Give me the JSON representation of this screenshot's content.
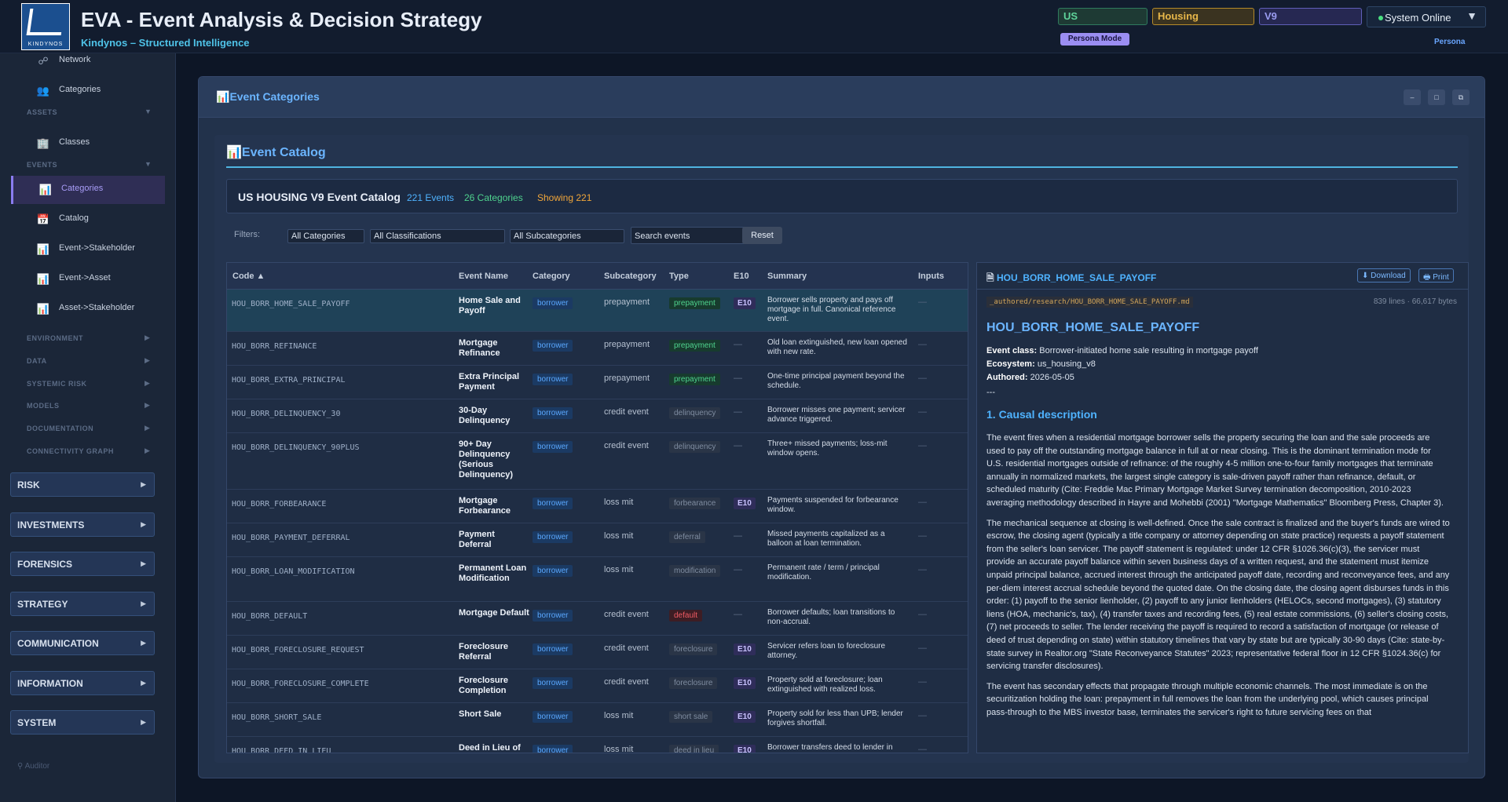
{
  "header": {
    "title": "EVA - Event Analysis & Decision Strategy",
    "subtitle": "Kindynos – Structured Intelligence",
    "logo_text": "KINDYNOS",
    "selectors": {
      "country": "US",
      "domain": "Housing",
      "version": "V9"
    },
    "persona_mode": "Persona Mode",
    "status": "System Online",
    "persona_link": "Persona"
  },
  "sidebar": {
    "items": [
      {
        "label": "Network",
        "icon": "network-icon"
      },
      {
        "label": "Categories",
        "icon": "users-icon"
      },
      {
        "label": "Classes",
        "icon": "building-icon"
      },
      {
        "label": "Categories",
        "icon": "chart-icon",
        "active": true
      },
      {
        "label": "Catalog",
        "icon": "calendar-icon"
      },
      {
        "label": "Event->Stakeholder",
        "icon": "chart-icon"
      },
      {
        "label": "Event->Asset",
        "icon": "chart-icon"
      },
      {
        "label": "Asset->Stakeholder",
        "icon": "chart-icon"
      }
    ],
    "sections": [
      "ASSETS",
      "EVENTS",
      "ENVIRONMENT",
      "DATA",
      "SYSTEMIC RISK",
      "MODELS",
      "DOCUMENTATION",
      "CONNECTIVITY GRAPH"
    ],
    "groups": [
      "RISK",
      "INVESTMENTS",
      "FORENSICS",
      "STRATEGY",
      "COMMUNICATION",
      "INFORMATION",
      "SYSTEM"
    ],
    "footer": "Auditor"
  },
  "panel": {
    "title": "Event Categories",
    "catalog_title": "Event Catalog",
    "stats": {
      "title": "US HOUSING V9 Event Catalog",
      "events": "221 Events",
      "categories": "26 Categories",
      "showing": "Showing 221"
    },
    "filters": {
      "label": "Filters:",
      "category": "All Categories",
      "classification": "All Classifications",
      "subcategory": "All Subcategories",
      "search_placeholder": "Search events",
      "reset": "Reset"
    },
    "table": {
      "headers": [
        "Code ▲",
        "Event Name",
        "Category",
        "Subcategory",
        "Type",
        "E10",
        "Summary",
        "Inputs"
      ],
      "rows": [
        {
          "code": "HOU_BORR_HOME_SALE_PAYOFF",
          "name": "Home Sale and Payoff",
          "category": "borrower",
          "subcategory": "prepayment",
          "type": "prepayment",
          "type_style": "prepay",
          "e10": "E10",
          "summary": "Borrower sells property and pays off mortgage in full. Canonical reference event.",
          "inputs": "—"
        },
        {
          "code": "HOU_BORR_REFINANCE",
          "name": "Mortgage Refinance",
          "category": "borrower",
          "subcategory": "prepayment",
          "type": "prepayment",
          "type_style": "prepay",
          "e10": "—",
          "summary": "Old loan extinguished, new loan opened with new rate.",
          "inputs": "—"
        },
        {
          "code": "HOU_BORR_EXTRA_PRINCIPAL",
          "name": "Extra Principal Payment",
          "category": "borrower",
          "subcategory": "prepayment",
          "type": "prepayment",
          "type_style": "prepay",
          "e10": "—",
          "summary": "One-time principal payment beyond the schedule.",
          "inputs": "—"
        },
        {
          "code": "HOU_BORR_DELINQUENCY_30",
          "name": "30-Day Delinquency",
          "category": "borrower",
          "subcategory": "credit event",
          "type": "delinquency",
          "type_style": "muted",
          "e10": "—",
          "summary": "Borrower misses one payment; servicer advance triggered.",
          "inputs": "—"
        },
        {
          "code": "HOU_BORR_DELINQUENCY_90PLUS",
          "name": "90+ Day Delinquency (Serious Delinquency)",
          "category": "borrower",
          "subcategory": "credit event",
          "type": "delinquency",
          "type_style": "muted",
          "e10": "—",
          "summary": "Three+ missed payments; loss-mit window opens.",
          "inputs": "—"
        },
        {
          "code": "HOU_BORR_FORBEARANCE",
          "name": "Mortgage Forbearance",
          "category": "borrower",
          "subcategory": "loss mit",
          "type": "forbearance",
          "type_style": "muted",
          "e10": "E10",
          "summary": "Payments suspended for forbearance window.",
          "inputs": "—"
        },
        {
          "code": "HOU_BORR_PAYMENT_DEFERRAL",
          "name": "Payment Deferral",
          "category": "borrower",
          "subcategory": "loss mit",
          "type": "deferral",
          "type_style": "muted",
          "e10": "—",
          "summary": "Missed payments capitalized as a balloon at loan termination.",
          "inputs": "—"
        },
        {
          "code": "HOU_BORR_LOAN_MODIFICATION",
          "name": "Permanent Loan Modification",
          "category": "borrower",
          "subcategory": "loss mit",
          "type": "modification",
          "type_style": "muted",
          "e10": "—",
          "summary": "Permanent rate / term / principal modification.",
          "inputs": "—"
        },
        {
          "code": "HOU_BORR_DEFAULT",
          "name": "Mortgage Default",
          "category": "borrower",
          "subcategory": "credit event",
          "type": "default",
          "type_style": "default",
          "e10": "—",
          "summary": "Borrower defaults; loan transitions to non-accrual.",
          "inputs": "—"
        },
        {
          "code": "HOU_BORR_FORECLOSURE_REQUEST",
          "name": "Foreclosure Referral",
          "category": "borrower",
          "subcategory": "credit event",
          "type": "foreclosure",
          "type_style": "muted",
          "e10": "E10",
          "summary": "Servicer refers loan to foreclosure attorney.",
          "inputs": "—"
        },
        {
          "code": "HOU_BORR_FORECLOSURE_COMPLETE",
          "name": "Foreclosure Completion",
          "category": "borrower",
          "subcategory": "credit event",
          "type": "foreclosure",
          "type_style": "muted",
          "e10": "E10",
          "summary": "Property sold at foreclosure; loan extinguished with realized loss.",
          "inputs": "—"
        },
        {
          "code": "HOU_BORR_SHORT_SALE",
          "name": "Short Sale",
          "category": "borrower",
          "subcategory": "loss mit",
          "type": "short sale",
          "type_style": "muted",
          "e10": "E10",
          "summary": "Property sold for less than UPB; lender forgives shortfall.",
          "inputs": "—"
        },
        {
          "code": "HOU_BORR_DEED_IN_LIEU",
          "name": "Deed in Lieu of",
          "category": "borrower",
          "subcategory": "loss mit",
          "type": "deed in lieu",
          "type_style": "muted",
          "e10": "E10",
          "summary": "Borrower transfers deed to lender in",
          "inputs": "—"
        }
      ]
    },
    "detail": {
      "file": "HOU_BORR_HOME_SALE_PAYOFF",
      "download": "⬇ Download",
      "print": "🖶 Print",
      "path": "_authored/research/HOU_BORR_HOME_SALE_PAYOFF.md",
      "meta": "839 lines · 66,617 bytes",
      "heading": "HOU_BORR_HOME_SALE_PAYOFF",
      "event_class_label": "Event class:",
      "event_class": "Borrower-initiated home sale resulting in mortgage payoff",
      "ecosystem_label": "Ecosystem:",
      "ecosystem": "us_housing_v8",
      "authored_label": "Authored:",
      "authored": "2026-05-05",
      "rule": "---",
      "section": "1. Causal description",
      "p1": "The event fires when a residential mortgage borrower sells the property securing the loan and the sale proceeds are used to pay off the outstanding mortgage balance in full at or near closing. This is the dominant termination mode for U.S. residential mortgages outside of refinance: of the roughly 4-5 million one-to-four family mortgages that terminate annually in normalized markets, the largest single category is sale-driven payoff rather than refinance, default, or scheduled maturity (Cite: Freddie Mac Primary Mortgage Market Survey termination decomposition, 2010-2023 averaging methodology described in Hayre and Mohebbi (2001) \"Mortgage Mathematics\" Bloomberg Press, Chapter 3).",
      "p2": "The mechanical sequence at closing is well-defined. Once the sale contract is finalized and the buyer's funds are wired to escrow, the closing agent (typically a title company or attorney depending on state practice) requests a payoff statement from the seller's loan servicer. The payoff statement is regulated: under 12 CFR §1026.36(c)(3), the servicer must provide an accurate payoff balance within seven business days of a written request, and the statement must itemize unpaid principal balance, accrued interest through the anticipated payoff date, recording and reconveyance fees, and any per-diem interest accrual schedule beyond the quoted date. On the closing date, the closing agent disburses funds in this order: (1) payoff to the senior lienholder, (2) payoff to any junior lienholders (HELOCs, second mortgages), (3) statutory liens (HOA, mechanic's, tax), (4) transfer taxes and recording fees, (5) real estate commissions, (6) seller's closing costs, (7) net proceeds to seller. The lender receiving the payoff is required to record a satisfaction of mortgage (or release of deed of trust depending on state) within statutory timelines that vary by state but are typically 30-90 days (Cite: state-by-state survey in Realtor.org \"State Reconveyance Statutes\" 2023; representative federal floor in 12 CFR §1024.36(c) for servicing transfer disclosures).",
      "p3": "The event has secondary effects that propagate through multiple economic channels. The most immediate is on the securitization holding the loan: prepayment in full removes the loan from the underlying pool, which causes principal pass-through to the MBS investor base, terminates the servicer's right to future servicing fees on that"
    }
  }
}
